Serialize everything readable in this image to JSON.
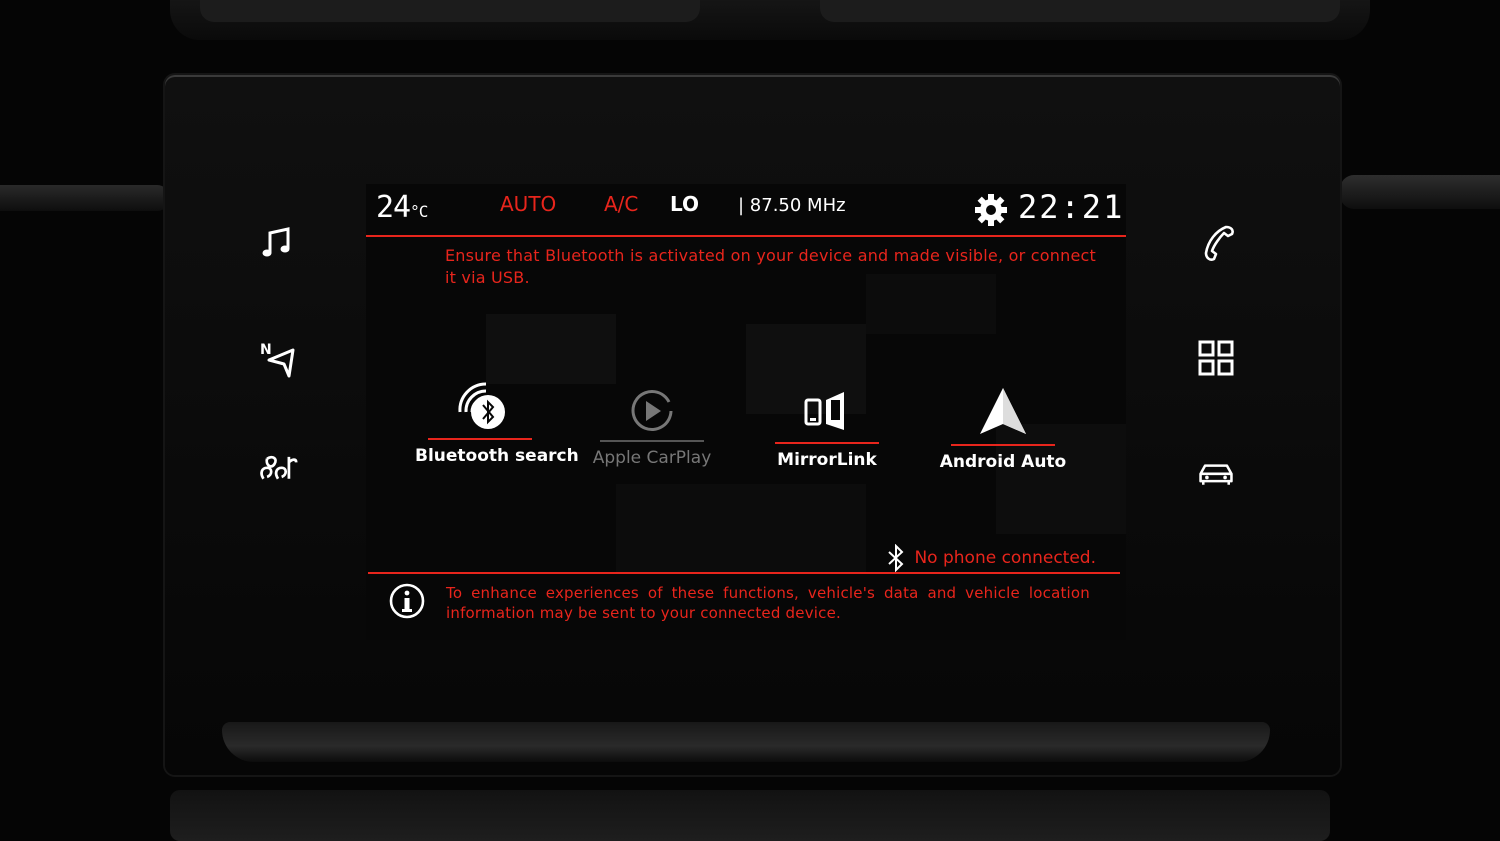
{
  "status_bar": {
    "temperature": "24",
    "temp_unit": "°C",
    "mode": "AUTO",
    "ac": "A/C",
    "fan": "LO",
    "radio": "| 87.50 MHz",
    "clock": "22:21"
  },
  "messages": {
    "bluetooth_hint": "Ensure that Bluetooth is activated on your device and made visible, or connect it via USB.",
    "connection_status": "No phone connected.",
    "privacy_notice": "To enhance experiences of these functions, vehicle's data and vehicle location information may be sent to your connected device."
  },
  "apps": [
    {
      "label": "Bluetooth search",
      "icon": "bluetooth-search-icon"
    },
    {
      "label": "Apple CarPlay",
      "icon": "play-circle-icon"
    },
    {
      "label": "MirrorLink",
      "icon": "mirrorlink-icon"
    },
    {
      "label": "Android Auto",
      "icon": "android-auto-icon"
    }
  ],
  "left_menu": [
    "music-note-icon",
    "navigation-icon",
    "climate-fan-icon"
  ],
  "right_menu": [
    "phone-icon",
    "apps-grid-icon",
    "car-icon"
  ],
  "colors": {
    "accent": "#e8251c",
    "text": "#ffffff",
    "background": "#070707"
  }
}
